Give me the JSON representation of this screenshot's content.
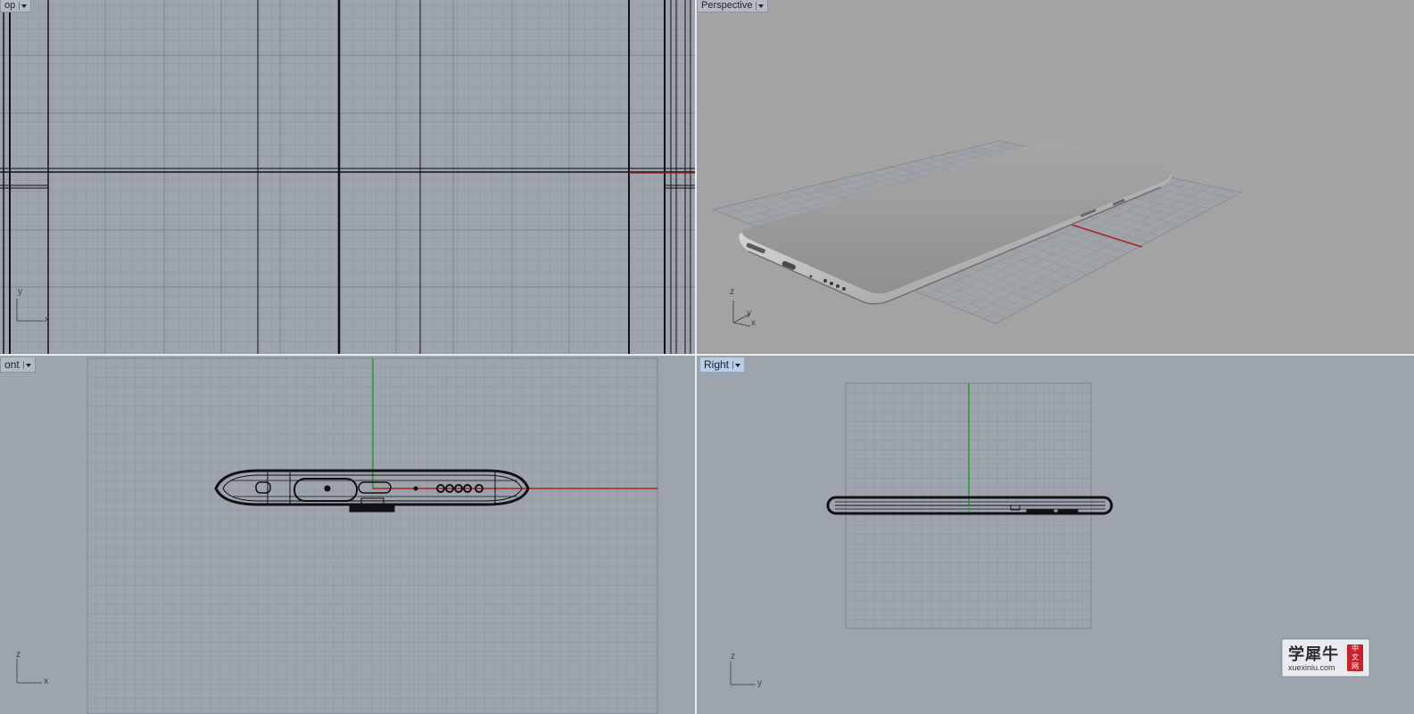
{
  "viewports": {
    "top": {
      "label": "op"
    },
    "perspective": {
      "label": "Perspective"
    },
    "front": {
      "label": "ont"
    },
    "right": {
      "label": "Right"
    }
  },
  "axes": {
    "top": {
      "a": "y",
      "b": "x"
    },
    "perspective": {
      "z": "z",
      "y": "y",
      "x": "x"
    },
    "front": {
      "a": "z",
      "b": "x"
    },
    "right": {
      "a": "z",
      "b": "y"
    }
  },
  "watermark": {
    "chinese": "学犀牛",
    "url": "xuexiniu.com",
    "seal": [
      "中",
      "文",
      "网"
    ]
  },
  "colors": {
    "viewport_bg": "#9da4ae",
    "perspective_bg": "#a3a3a3",
    "x_axis": "#b02020",
    "y_axis": "#20a020",
    "active_tab": "#b7cde6"
  },
  "icons": {
    "viewport_menu": "chevron-down-icon",
    "axis": "axis-gizmo-icon"
  }
}
